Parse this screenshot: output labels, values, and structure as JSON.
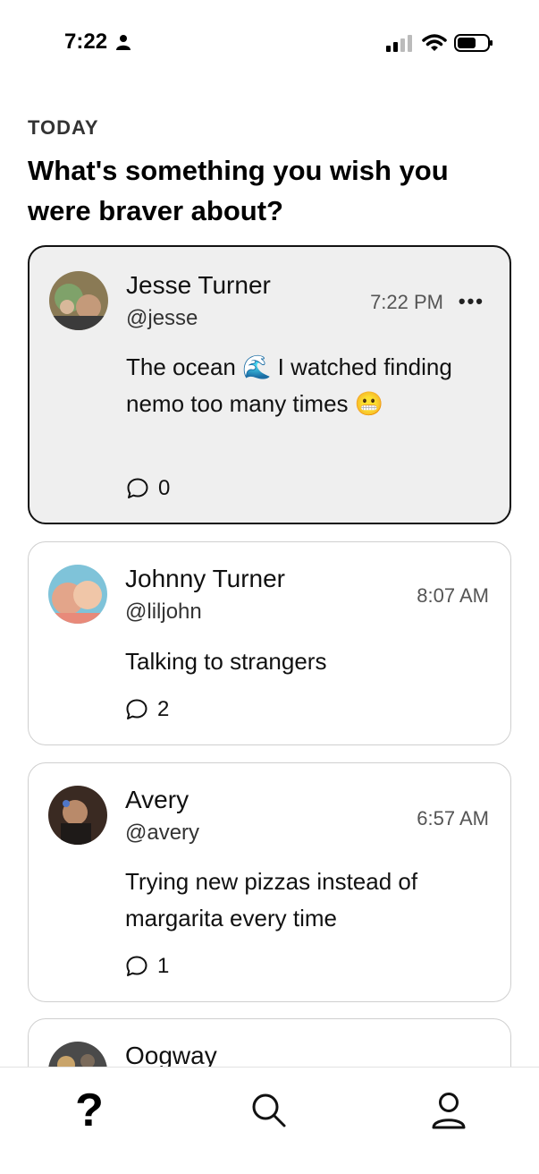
{
  "status_bar": {
    "time": "7:22"
  },
  "section_label": "TODAY",
  "prompt": "What's something you wish you were braver about?",
  "posts": [
    {
      "name": "Jesse Turner",
      "handle": "@jesse",
      "time": "7:22 PM",
      "text": "The ocean 🌊 I watched finding nemo too many times 😬",
      "comments": "0",
      "more": "•••"
    },
    {
      "name": "Johnny Turner",
      "handle": "@liljohn",
      "time": "8:07 AM",
      "text": "Talking to strangers",
      "comments": "2"
    },
    {
      "name": "Avery",
      "handle": "@avery",
      "time": "6:57 AM",
      "text": "Trying new pizzas instead of margarita every time",
      "comments": "1"
    },
    {
      "name": "Oogway"
    }
  ],
  "tab_bar": {
    "question_tab": "?"
  }
}
